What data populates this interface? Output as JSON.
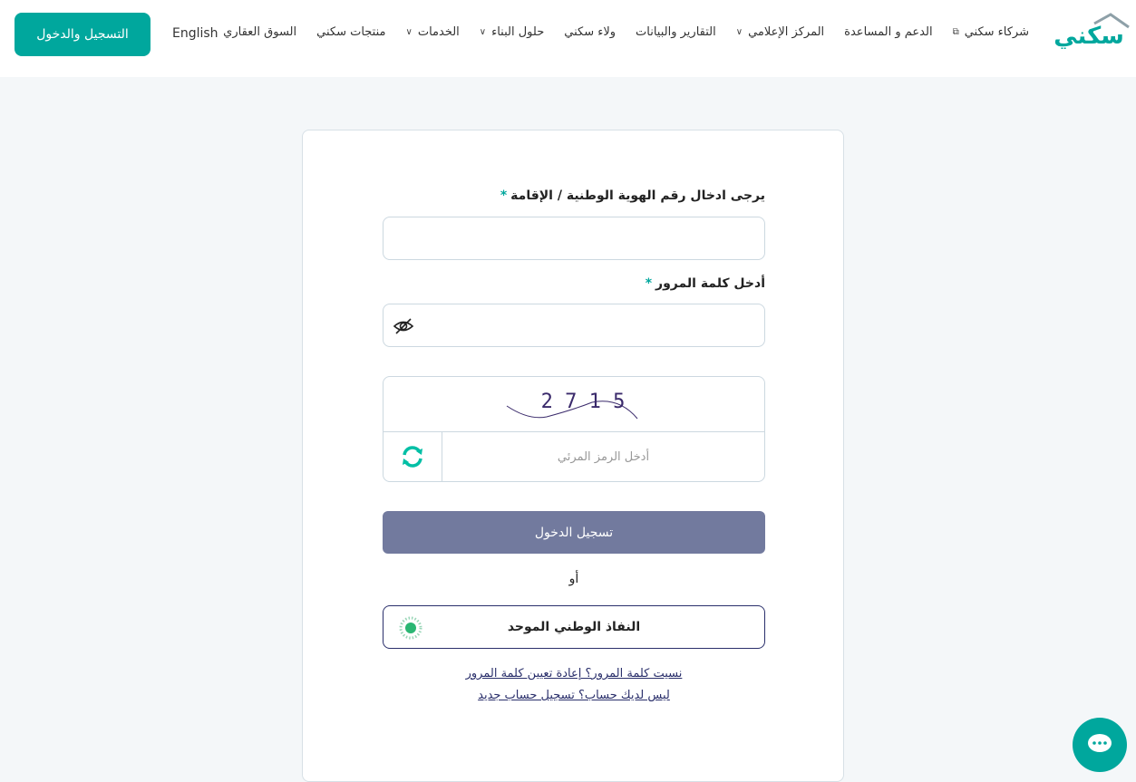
{
  "header": {
    "logo_text": "سكني",
    "nav": [
      {
        "label": "السوق العقاري",
        "dropdown": false
      },
      {
        "label": "منتجات سكني",
        "dropdown": false
      },
      {
        "label": "الخدمات",
        "dropdown": true
      },
      {
        "label": "حلول البناء",
        "dropdown": true
      },
      {
        "label": "ولاء سكني",
        "dropdown": false
      },
      {
        "label": "التقارير والبيانات",
        "dropdown": false
      },
      {
        "label": "المركز الإعلامي",
        "dropdown": true
      },
      {
        "label": "الدعم و المساعدة",
        "dropdown": false
      },
      {
        "label": "شركاء سكني",
        "dropdown": false,
        "external": true
      }
    ],
    "language": "English",
    "login_button": "التسجيل والدخول"
  },
  "form": {
    "id_label": "يرجى ادخال رقم الهوية الوطنية / الإقامة",
    "id_value": "",
    "password_label": "أدخل كلمة المرور",
    "password_value": "",
    "required_mark": "*",
    "captcha_text": "5 1 7 2",
    "captcha_placeholder": "أدخل الرمز المرئي",
    "submit": "تسجيل الدخول",
    "or": "أو",
    "nafath": "النفاذ الوطني الموحد",
    "forgot": "نسيت كلمة المرور؟ إعادة تعيين كلمة المرور",
    "register": "ليس لديك حساب؟ تسجيل حساب جديد"
  },
  "colors": {
    "brand": "#00a79d",
    "submit": "#727a9e",
    "navy": "#2a2f6b"
  }
}
